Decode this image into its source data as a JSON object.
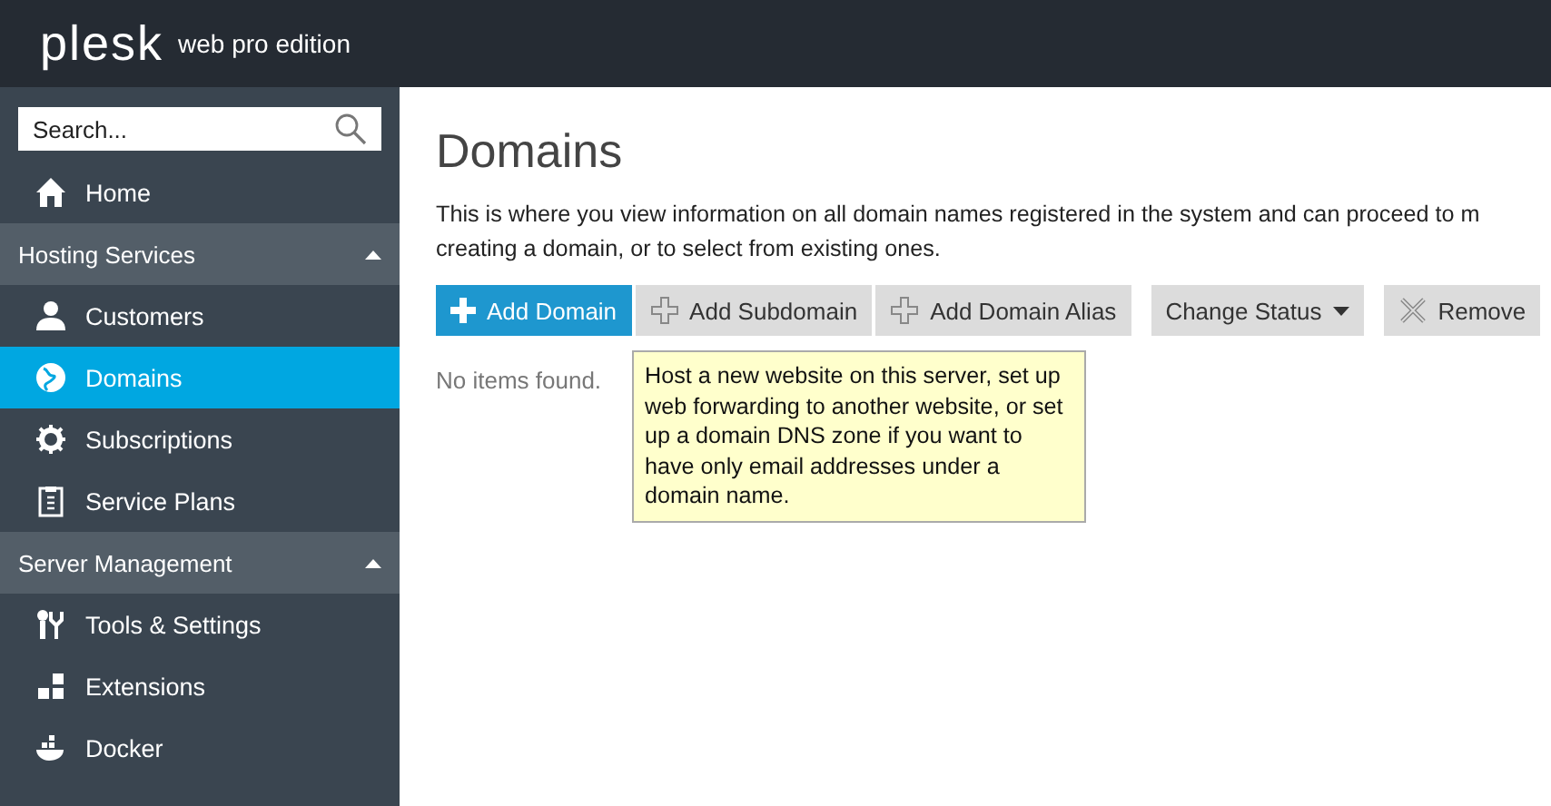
{
  "header": {
    "logo": "plesk",
    "edition": "web pro edition"
  },
  "sidebar": {
    "search": {
      "placeholder": "Search..."
    },
    "items": [
      {
        "kind": "item",
        "label": "Home",
        "selected": false
      },
      {
        "kind": "group",
        "label": "Hosting Services",
        "expanded": true
      },
      {
        "kind": "item",
        "label": "Customers",
        "selected": false
      },
      {
        "kind": "item",
        "label": "Domains",
        "selected": true
      },
      {
        "kind": "item",
        "label": "Subscriptions",
        "selected": false
      },
      {
        "kind": "item",
        "label": "Service Plans",
        "selected": false
      },
      {
        "kind": "group",
        "label": "Server Management",
        "expanded": true
      },
      {
        "kind": "item",
        "label": "Tools & Settings",
        "selected": false
      },
      {
        "kind": "item",
        "label": "Extensions",
        "selected": false
      },
      {
        "kind": "item",
        "label": "Docker",
        "selected": false
      }
    ]
  },
  "page": {
    "title": "Domains",
    "description": "This is where you view information on all domain names registered in the system and can proceed to m\ncreating a domain, or to select from existing ones.",
    "toolbar": [
      {
        "kind": "primary",
        "label": "Add Domain"
      },
      {
        "kind": "add",
        "label": "Add Subdomain"
      },
      {
        "kind": "add",
        "label": "Add Domain Alias"
      },
      {
        "kind": "dropdown",
        "label": "Change Status"
      },
      {
        "kind": "remove",
        "label": "Remove"
      }
    ],
    "empty": "No items found.",
    "tooltip": "Host a new website on this server, set up web forwarding to another website, or set up a domain DNS zone if you want to have only email addresses under a domain name."
  }
}
